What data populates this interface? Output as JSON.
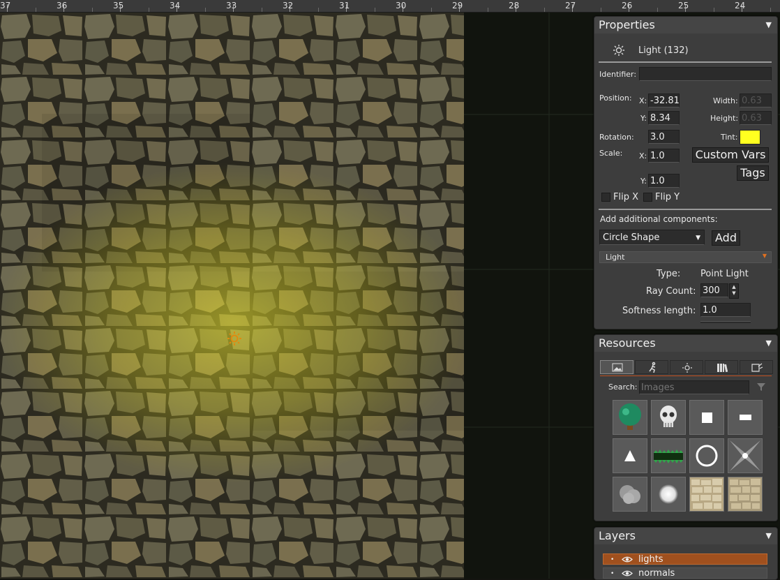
{
  "ruler": {
    "labels": [
      "37",
      "36",
      "35",
      "34",
      "33",
      "32",
      "31",
      "30",
      "29",
      "28",
      "27",
      "26",
      "25",
      "24"
    ]
  },
  "colors": {
    "panel_bg": "#3d3d3d",
    "accent_orange": "#a0501e",
    "tint_yellow": "#ffff20",
    "canvas_bg": "#11140e"
  },
  "properties": {
    "title": "Properties",
    "object_icon": "sun-icon",
    "object_name": "Light (132)",
    "identifier_label": "Identifier:",
    "identifier_value": "",
    "position_label": "Position:",
    "x_label": "X:",
    "x_value": "-32.81",
    "y_label": "Y:",
    "y_value": "8.34",
    "width_label": "Width:",
    "width_value": "0.63",
    "height_label": "Height:",
    "height_value": "0.63",
    "rotation_label": "Rotation:",
    "rotation_value": "3.0",
    "tint_label": "Tint:",
    "scale_label": "Scale:",
    "scale_x_label": "X:",
    "scale_x_value": "1.0",
    "scale_y_label": "Y:",
    "scale_y_value": "1.0",
    "custom_vars_label": "Custom Vars",
    "tags_label": "Tags",
    "flip_x_label": "Flip X",
    "flip_y_label": "Flip Y",
    "add_components_label": "Add additional components:",
    "component_select": "Circle Shape",
    "add_button": "Add",
    "light_section": "Light",
    "type_label": "Type:",
    "type_value": "Point Light",
    "ray_count_label": "Ray Count:",
    "ray_count_value": "300",
    "softness_label": "Softness length:",
    "softness_value": "1.0"
  },
  "resources": {
    "title": "Resources",
    "tabs": [
      {
        "icon": "image-icon"
      },
      {
        "icon": "running-figure-icon"
      },
      {
        "icon": "sun-icon"
      },
      {
        "icon": "books-icon"
      },
      {
        "icon": "script-icon"
      }
    ],
    "search_label": "Search:",
    "search_placeholder": "Images",
    "filter_icon": "filter-icon",
    "tiles": [
      {
        "name": "tree-image"
      },
      {
        "name": "skull-image"
      },
      {
        "name": "white-square-image"
      },
      {
        "name": "white-bar-image"
      },
      {
        "name": "triangle-image"
      },
      {
        "name": "green-grass-image"
      },
      {
        "name": "ring-image"
      },
      {
        "name": "star-sparkle-image"
      },
      {
        "name": "smoke-cloud-image"
      },
      {
        "name": "soft-circle-image"
      },
      {
        "name": "stone-wall-image"
      },
      {
        "name": "stone-wall-normal-image"
      }
    ]
  },
  "layers": {
    "title": "Layers",
    "items": [
      {
        "name": "lights",
        "active": true
      },
      {
        "name": "normals",
        "active": false
      }
    ]
  }
}
